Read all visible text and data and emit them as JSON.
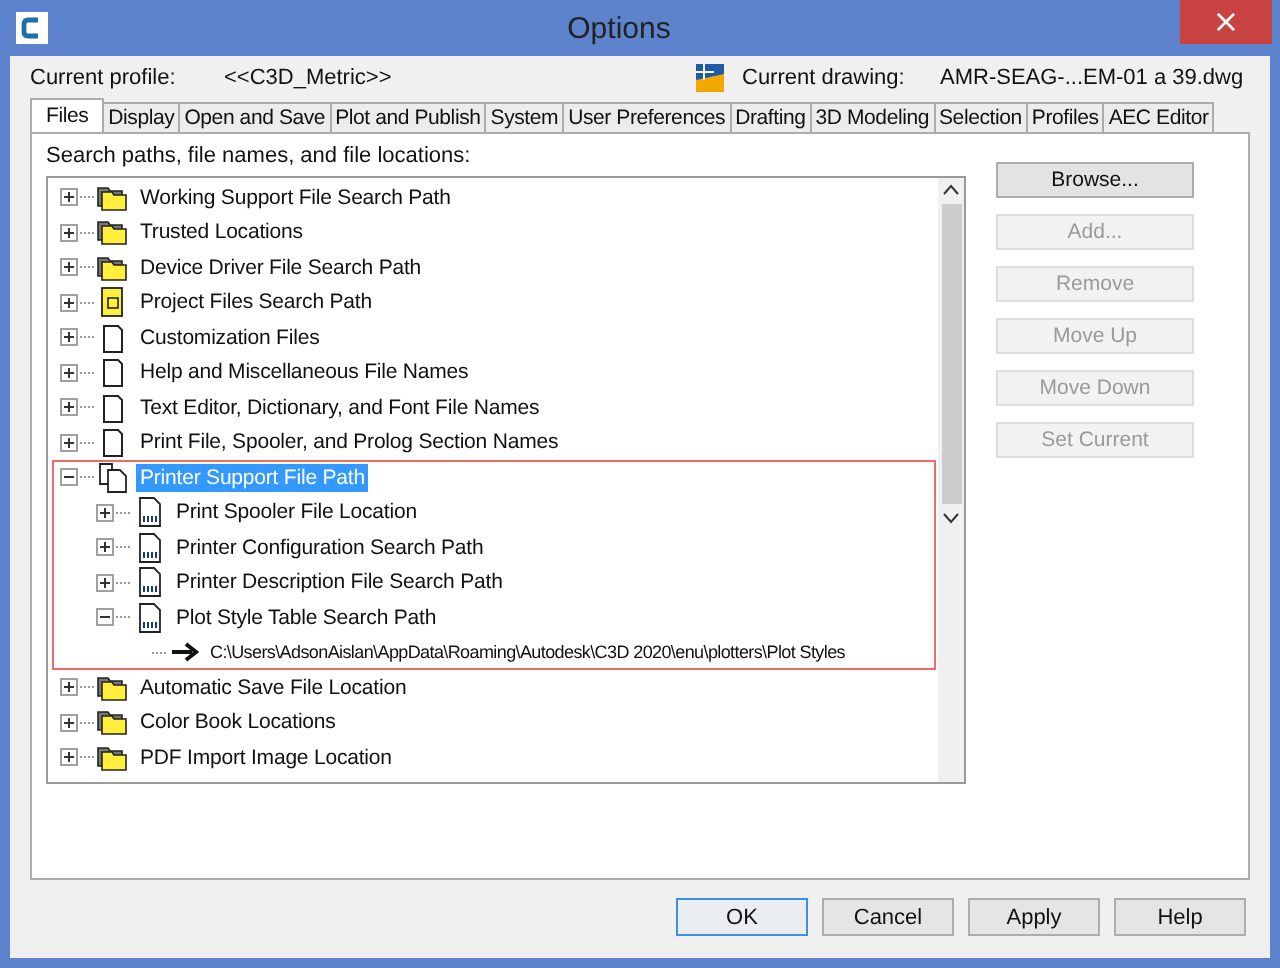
{
  "window": {
    "title": "Options",
    "close_label": "×"
  },
  "profile": {
    "label": "Current profile:",
    "value": "<<C3D_Metric>>",
    "drawing_label": "Current drawing:",
    "drawing_value": "AMR-SEAG-...EM-01 a 39.dwg"
  },
  "tabs": [
    {
      "label": "Files",
      "selected": true
    },
    {
      "label": "Display",
      "selected": false
    },
    {
      "label": "Open and Save",
      "selected": false
    },
    {
      "label": "Plot and Publish",
      "selected": false
    },
    {
      "label": "System",
      "selected": false
    },
    {
      "label": "User Preferences",
      "selected": false
    },
    {
      "label": "Drafting",
      "selected": false
    },
    {
      "label": "3D Modeling",
      "selected": false
    },
    {
      "label": "Selection",
      "selected": false
    },
    {
      "label": "Profiles",
      "selected": false
    },
    {
      "label": "AEC Editor",
      "selected": false
    }
  ],
  "tree": {
    "label": "Search paths, file names, and file locations:",
    "items": [
      {
        "label": "Working Support File Search Path",
        "kind": "folder",
        "expanded": false,
        "selected": false
      },
      {
        "label": "Trusted Locations",
        "kind": "folder",
        "expanded": false,
        "selected": false
      },
      {
        "label": "Device Driver File Search Path",
        "kind": "folder",
        "expanded": false,
        "selected": false
      },
      {
        "label": "Project Files Search Path",
        "kind": "project",
        "expanded": false,
        "selected": false
      },
      {
        "label": "Customization Files",
        "kind": "file",
        "expanded": false,
        "selected": false
      },
      {
        "label": "Help and Miscellaneous File Names",
        "kind": "file",
        "expanded": false,
        "selected": false
      },
      {
        "label": "Text Editor, Dictionary, and Font File Names",
        "kind": "file",
        "expanded": false,
        "selected": false
      },
      {
        "label": "Print File, Spooler, and Prolog Section Names",
        "kind": "file",
        "expanded": false,
        "selected": false
      },
      {
        "label": "Printer Support File Path",
        "kind": "printer",
        "expanded": true,
        "selected": true,
        "children": [
          {
            "label": "Print Spooler File Location",
            "kind": "plot",
            "expanded": false,
            "selected": false
          },
          {
            "label": "Printer Configuration Search Path",
            "kind": "plot",
            "expanded": false,
            "selected": false
          },
          {
            "label": "Printer Description File Search Path",
            "kind": "plot",
            "expanded": false,
            "selected": false
          },
          {
            "label": "Plot Style Table Search Path",
            "kind": "plot",
            "expanded": true,
            "selected": false,
            "children": [
              {
                "label": "C:\\Users\\AdsonAislan\\AppData\\Roaming\\Autodesk\\C3D 2020\\enu\\plotters\\Plot Styles",
                "kind": "path",
                "selected": false
              }
            ]
          }
        ]
      },
      {
        "label": "Automatic Save File Location",
        "kind": "folder",
        "expanded": false,
        "selected": false
      },
      {
        "label": "Color Book Locations",
        "kind": "folder",
        "expanded": false,
        "selected": false
      },
      {
        "label": "PDF Import Image Location",
        "kind": "folder",
        "expanded": false,
        "selected": false
      }
    ]
  },
  "side_buttons": [
    {
      "label": "Browse...",
      "disabled": false
    },
    {
      "label": "Add...",
      "disabled": true
    },
    {
      "label": "Remove",
      "disabled": true
    },
    {
      "label": "Move Up",
      "disabled": true
    },
    {
      "label": "Move Down",
      "disabled": true
    },
    {
      "label": "Set Current",
      "disabled": true
    }
  ],
  "buttons": [
    {
      "label": "OK",
      "default": true
    },
    {
      "label": "Cancel",
      "default": false
    },
    {
      "label": "Apply",
      "default": false
    },
    {
      "label": "Help",
      "default": false
    }
  ]
}
